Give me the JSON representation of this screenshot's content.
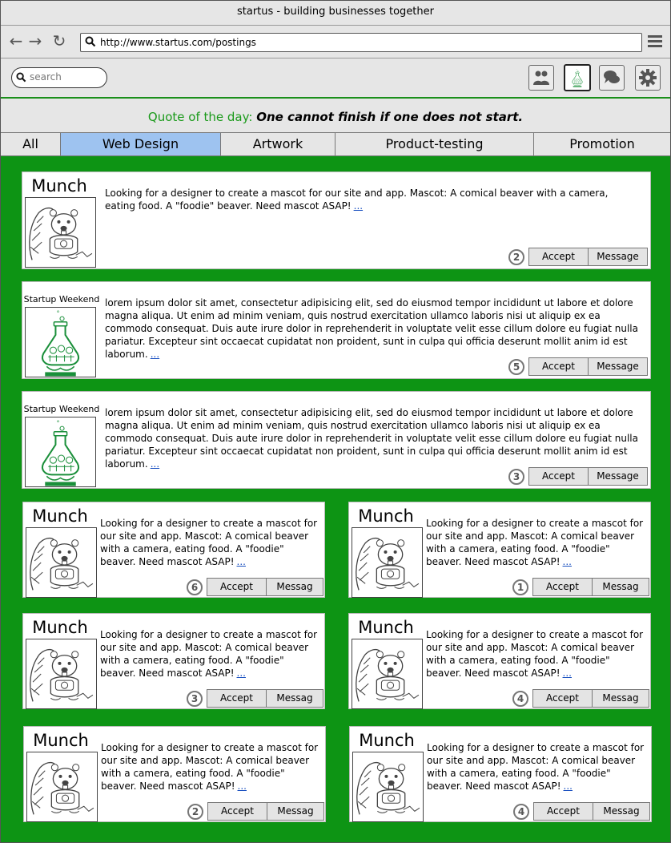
{
  "window": {
    "title": "startus - building businesses together"
  },
  "browser": {
    "url": "http://www.startus.com/postings"
  },
  "search": {
    "placeholder": "search"
  },
  "toolbar": {
    "icons": [
      "group-icon",
      "flask-logo-icon",
      "chat-icon",
      "gear-icon"
    ]
  },
  "quote": {
    "label": "Quote of the day:",
    "text": "One cannot finish if one does not start."
  },
  "tabs": [
    {
      "label": "All"
    },
    {
      "label": "Web Design"
    },
    {
      "label": "Artwork"
    },
    {
      "label": "Product-testing"
    },
    {
      "label": "Promotion"
    }
  ],
  "active_tab": "Web Design",
  "colors": {
    "accent_green": "#0d9414",
    "active_tab": "#9ec3f0",
    "quote_label": "#1a9a1a",
    "link": "#1a50c0"
  },
  "postings": [
    {
      "brand": "Munch",
      "text": "Looking for a designer to create a mascot for our site and app. Mascot: A comical beaver with a camera, eating food. A \"foodie\" beaver. Need mascot ASAP!",
      "more": "...",
      "count": "2",
      "accept": "Accept",
      "message": "Message"
    },
    {
      "brand": "Startup Weekend",
      "text": "lorem ipsum dolor sit amet, consectetur adipisicing elit, sed do eiusmod tempor incididunt ut labore et dolore magna aliqua. Ut enim ad minim veniam, quis nostrud exercitation ullamco laboris nisi ut aliquip ex ea commodo consequat. Duis aute irure dolor in reprehenderit in voluptate velit esse cillum dolore eu fugiat nulla pariatur. Excepteur sint occaecat cupidatat non proident, sunt in culpa qui officia deserunt mollit anim id est laborum.",
      "more": "...",
      "count": "5",
      "accept": "Accept",
      "message": "Message"
    },
    {
      "brand": "Startup Weekend",
      "text": "lorem ipsum dolor sit amet, consectetur adipisicing elit, sed do eiusmod tempor incididunt ut labore et dolore magna aliqua. Ut enim ad minim veniam, quis nostrud exercitation ullamco laboris nisi ut aliquip ex ea commodo consequat. Duis aute irure dolor in reprehenderit in voluptate velit esse cillum dolore eu fugiat nulla pariatur. Excepteur sint occaecat cupidatat non proident, sunt in culpa qui officia deserunt mollit anim id est laborum.",
      "more": "...",
      "count": "3",
      "accept": "Accept",
      "message": "Message"
    },
    {
      "brand": "Munch",
      "text": "Looking for a designer to create a mascot for our site and app. Mascot: A comical beaver with a camera, eating food. A \"foodie\" beaver. Need mascot ASAP!",
      "more": "...",
      "count": "6",
      "accept": "Accept",
      "message": "Messag"
    },
    {
      "brand": "Munch",
      "text": "Looking for a designer to create a mascot for our site and app. Mascot: A comical beaver with a camera, eating food. A \"foodie\" beaver. Need mascot ASAP!",
      "more": "...",
      "count": "1",
      "accept": "Accept",
      "message": "Messag"
    },
    {
      "brand": "Munch",
      "text": "Looking for a designer to create a mascot for our site and app. Mascot: A comical beaver with a camera, eating food. A \"foodie\" beaver. Need mascot ASAP!",
      "more": "...",
      "count": "3",
      "accept": "Accept",
      "message": "Messag"
    },
    {
      "brand": "Munch",
      "text": "Looking for a designer to create a mascot for our site and app. Mascot: A comical beaver with a camera, eating food. A \"foodie\" beaver. Need mascot ASAP!",
      "more": "...",
      "count": "4",
      "accept": "Accept",
      "message": "Messag"
    },
    {
      "brand": "Munch",
      "text": "Looking for a designer to create a mascot for our site and app. Mascot: A comical beaver with a camera, eating food. A \"foodie\" beaver. Need mascot ASAP!",
      "more": "...",
      "count": "2",
      "accept": "Accept",
      "message": "Messag"
    },
    {
      "brand": "Munch",
      "text": "Looking for a designer to create a mascot for our site and app. Mascot: A comical beaver with a camera, eating food. A \"foodie\" beaver. Need mascot ASAP!",
      "more": "...",
      "count": "4",
      "accept": "Accept",
      "message": "Messag"
    }
  ]
}
